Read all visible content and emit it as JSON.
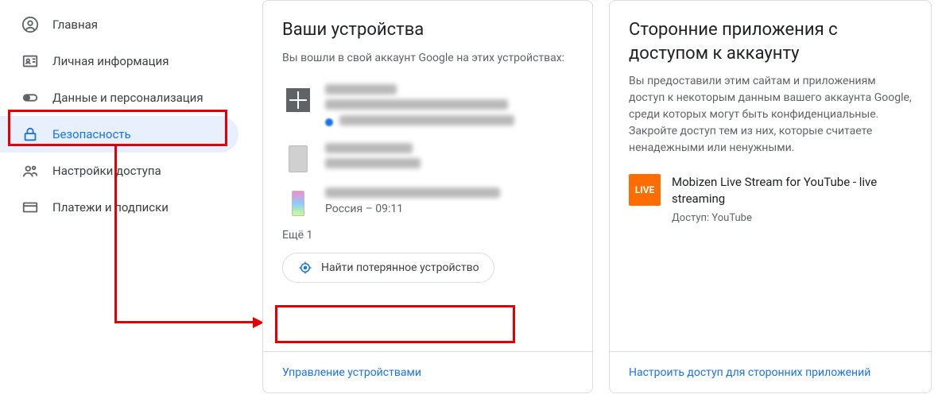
{
  "sidebar": {
    "items": [
      {
        "label": "Главная"
      },
      {
        "label": "Личная информация"
      },
      {
        "label": "Данные и персонализация"
      },
      {
        "label": "Безопасность"
      },
      {
        "label": "Настройки доступа"
      },
      {
        "label": "Платежи и подписки"
      }
    ]
  },
  "devices_card": {
    "title": "Ваши устройства",
    "description": "Вы вошли в свой аккаунт Google на этих устройствах:",
    "more": "Ещё 1",
    "device3_sub": "Россия – 09:11",
    "find_button": "Найти потерянное устройство",
    "footer": "Управление устройствами"
  },
  "apps_card": {
    "title": "Сторонние приложения с доступом к аккаунту",
    "description": "Вы предоставили этим сайтам и приложениям доступ к некоторым данным вашего аккаунта Google, среди которых могут быть конфиденциальные. Закройте доступ тем из них, которые считаете ненадежными или ненужными.",
    "app_icon_text": "LIVE",
    "app_name": "Mobizen Live Stream for YouTube - live streaming",
    "app_access": "Доступ: YouTube",
    "footer": "Настроить доступ для сторонних приложений"
  }
}
